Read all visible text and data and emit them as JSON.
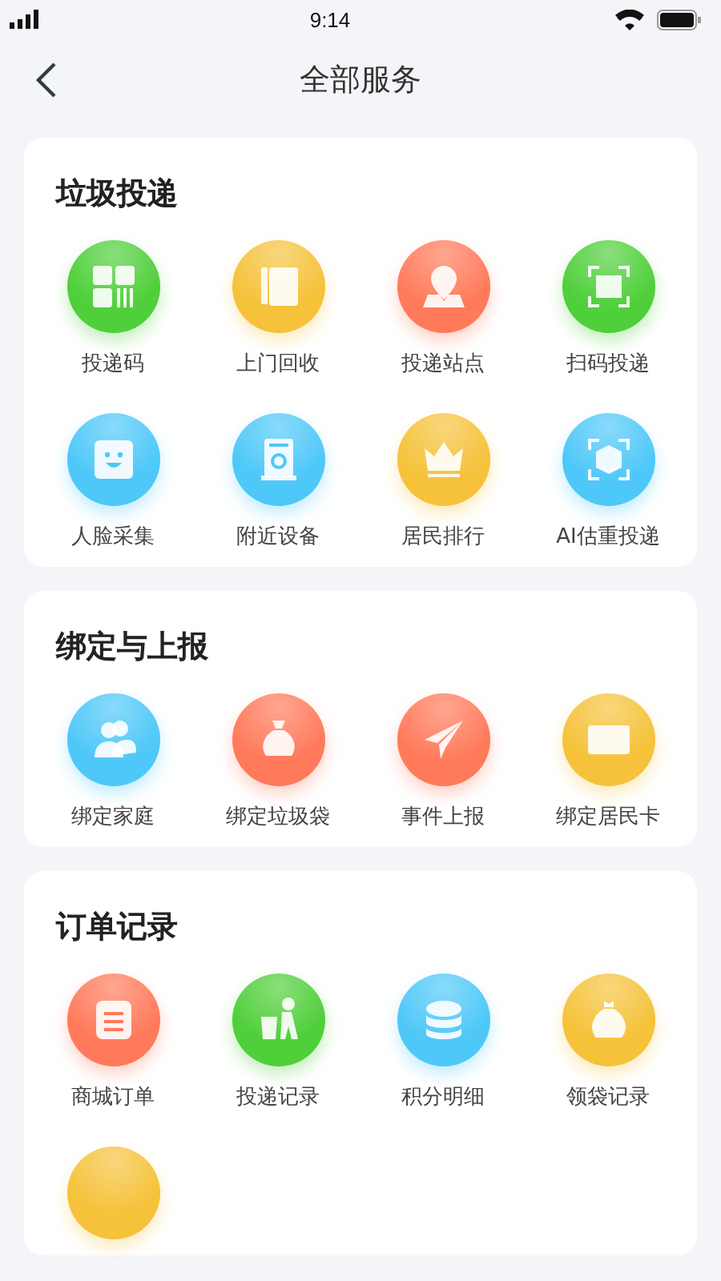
{
  "status_bar": {
    "time": "9:14"
  },
  "header": {
    "title": "全部服务"
  },
  "sections": [
    {
      "title": "垃圾投递",
      "items": [
        {
          "label": "投递码",
          "kind": "grid",
          "color": "#4fcf3a"
        },
        {
          "label": "上门回收",
          "kind": "door",
          "color": "#f5c23a"
        },
        {
          "label": "投递站点",
          "kind": "pin",
          "color": "#ff7a5a"
        },
        {
          "label": "扫码投递",
          "kind": "scan",
          "color": "#4fcf3a"
        },
        {
          "label": "人脸采集",
          "kind": "face",
          "color": "#4ec8f8"
        },
        {
          "label": "附近设备",
          "kind": "machine",
          "color": "#4ec8f8"
        },
        {
          "label": "居民排行",
          "kind": "crown",
          "color": "#f5c23a"
        },
        {
          "label": "AI估重投递",
          "kind": "cube",
          "color": "#4ec8f8"
        }
      ]
    },
    {
      "title": "绑定与上报",
      "items": [
        {
          "label": "绑定家庭",
          "kind": "family",
          "color": "#4ec8f8"
        },
        {
          "label": "绑定垃圾袋",
          "kind": "sack",
          "color": "#ff7a5a"
        },
        {
          "label": "事件上报",
          "kind": "plane",
          "color": "#ff7a5a"
        },
        {
          "label": "绑定居民卡",
          "kind": "card",
          "color": "#f5c23a"
        }
      ]
    },
    {
      "title": "订单记录",
      "items": [
        {
          "label": "商城订单",
          "kind": "list",
          "color": "#ff7a5a"
        },
        {
          "label": "投递记录",
          "kind": "bin",
          "color": "#4fcf3a"
        },
        {
          "label": "积分明细",
          "kind": "coins",
          "color": "#4ec8f8"
        },
        {
          "label": "领袋记录",
          "kind": "bag",
          "color": "#f5c23a"
        },
        {
          "kind": "blank",
          "color": "#f5c23a"
        }
      ]
    }
  ]
}
